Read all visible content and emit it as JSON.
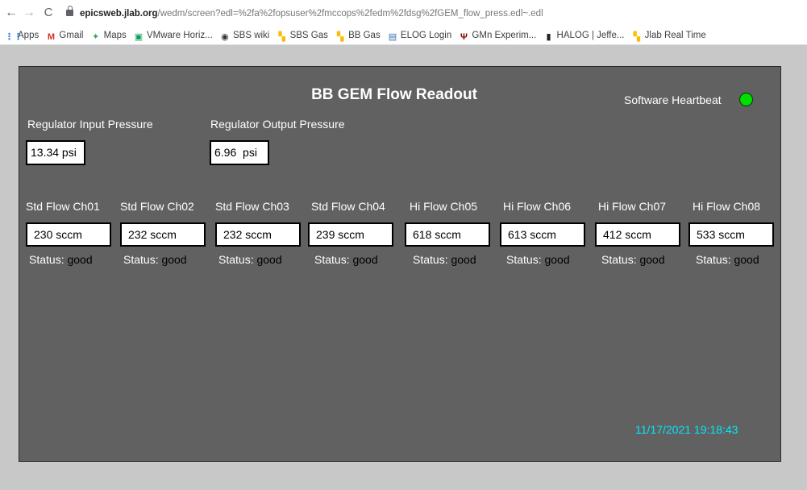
{
  "browser": {
    "nav": {
      "back": "←",
      "forward": "→",
      "reload": "C"
    },
    "url_domain": "epicsweb.jlab.org",
    "url_path": "/wedm/screen?edl=%2fa%2fopsuser%2fmccops%2fedm%2fdsg%2fGEM_flow_press.edl~.edl",
    "bookmarks": [
      {
        "label": "Apps",
        "icon": "apps-grid-icon",
        "color": "#1a73e8"
      },
      {
        "label": "Gmail",
        "icon": "gmail-icon",
        "color": "#d93025"
      },
      {
        "label": "Maps",
        "icon": "maps-icon",
        "color": "#34a853"
      },
      {
        "label": "VMware Horiz...",
        "icon": "vmware-icon",
        "color": "#0f9d58"
      },
      {
        "label": "SBS wiki",
        "icon": "wiki-icon",
        "color": "#333333"
      },
      {
        "label": "SBS Gas",
        "icon": "sbs-gas-icon",
        "color": "#fbbc04"
      },
      {
        "label": "BB Gas",
        "icon": "bb-gas-icon",
        "color": "#fbbc04"
      },
      {
        "label": "ELOG Login",
        "icon": "elog-icon",
        "color": "#3c6eb4"
      },
      {
        "label": "GMn Experim...",
        "icon": "gmn-icon",
        "color": "#8b0000"
      },
      {
        "label": "HALOG | Jeffe...",
        "icon": "halog-icon",
        "color": "#202124"
      },
      {
        "label": "Jlab Real Time",
        "icon": "jlab-icon",
        "color": "#fbbc04"
      }
    ]
  },
  "screen": {
    "title": "BB GEM Flow Readout",
    "heartbeat_label": "Software Heartbeat",
    "heartbeat_color": "#00e000",
    "regulator_input": {
      "label": "Regulator Input Pressure",
      "value": "13.34 psi"
    },
    "regulator_output": {
      "label": "Regulator Output Pressure",
      "value": "6.96  psi"
    },
    "status_prefix": "Status:",
    "channels": [
      {
        "label": "Std Flow Ch01",
        "value": "230 sccm",
        "status": "good"
      },
      {
        "label": "Std Flow Ch02",
        "value": "232 sccm",
        "status": "good"
      },
      {
        "label": "Std Flow Ch03",
        "value": "232 sccm",
        "status": "good"
      },
      {
        "label": "Std Flow Ch04",
        "value": "239 sccm",
        "status": "good"
      },
      {
        "label": "Hi Flow Ch05",
        "value": "618 sccm",
        "status": "good"
      },
      {
        "label": "Hi Flow Ch06",
        "value": "613 sccm",
        "status": "good"
      },
      {
        "label": "Hi Flow Ch07",
        "value": "412 sccm",
        "status": "good"
      },
      {
        "label": "Hi Flow Ch08",
        "value": "533 sccm",
        "status": "good"
      }
    ],
    "timestamp": "11/17/2021 19:18:43",
    "timestamp_color": "#00e8ff"
  }
}
